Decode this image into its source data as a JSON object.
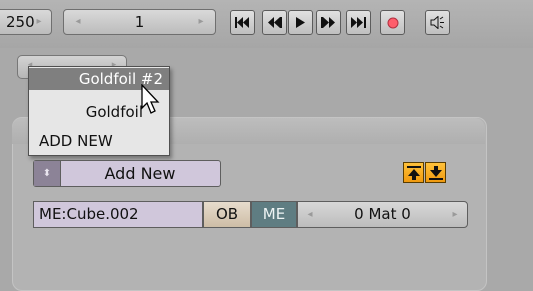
{
  "header": {
    "frame_value": "250",
    "frame_arrow": "▸",
    "current_value": "1",
    "left_arrow": "◂",
    "right_arrow": "▸"
  },
  "buttons": {
    "jump_start": "jump-to-start",
    "prev_key": "previous-keyframe",
    "play": "play",
    "next_key": "next-keyframe",
    "jump_end": "jump-to-end",
    "record": "record",
    "audio": "audio-scrub"
  },
  "dropdown": {
    "items": [
      {
        "label": "Goldfoil #2",
        "state": "highlighted"
      },
      {
        "label": "Goldfoil",
        "state": "normal"
      },
      {
        "label": "ADD NEW",
        "state": "normal"
      }
    ]
  },
  "material": {
    "add_new_label": "Add New",
    "mesh_field": "ME:Cube.002",
    "ob_label": "OB",
    "me_label": "ME",
    "mat_label": "0 Mat 0",
    "left_arrow": "◂",
    "right_arrow": "▸"
  },
  "colors": {
    "highlight": "#7f7f7f",
    "accent_orange": "#f5a623",
    "me_active": "#5f7d82",
    "record_red": "#ff5d6b"
  }
}
